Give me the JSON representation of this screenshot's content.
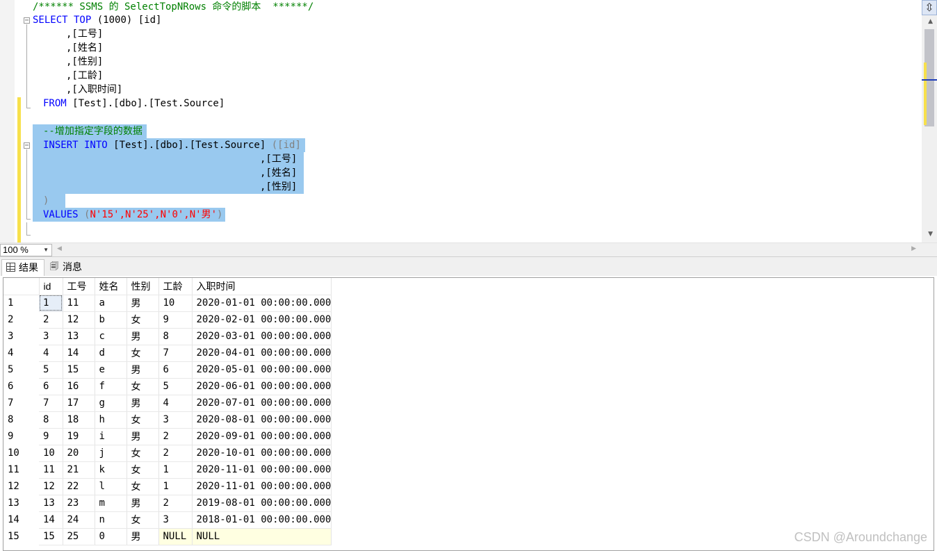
{
  "editor": {
    "comment_header": "/****** SSMS 的 SelectTopNRows 命令的脚本  ******/",
    "select_kw": "SELECT TOP",
    "select_rest": " (1000) [id]",
    "select_cols": [
      ",[工号]",
      ",[姓名]",
      ",[性别]",
      ",[工龄]",
      ",[入职时间]"
    ],
    "from_kw": "FROM",
    "from_rest": " [Test].[dbo].[Test.Source]",
    "comment_line": "--增加指定字段的数据",
    "insert_kw": "INSERT INTO",
    "insert_table": " [Test].[dbo].[Test.Source] ",
    "insert_first_col": "([id]",
    "insert_cols": [
      ",[工号]",
      ",[姓名]",
      ",[性别]"
    ],
    "close_paren": ")",
    "values_kw": "VALUES",
    "values_paren_open": " (",
    "values_items": "N'15',N'25',N'0',N'男'",
    "values_paren_close": ")"
  },
  "zoom": {
    "value": "100 %"
  },
  "tabs": [
    {
      "label": "结果",
      "icon": "grid-icon",
      "active": true
    },
    {
      "label": "消息",
      "icon": "messages-icon",
      "active": false
    }
  ],
  "results": {
    "columns": [
      "id",
      "工号",
      "姓名",
      "性别",
      "工龄",
      "入职时间"
    ],
    "rows": [
      [
        "1",
        "1",
        "11",
        "a",
        "男",
        "10",
        "2020-01-01 00:00:00.000"
      ],
      [
        "2",
        "2",
        "12",
        "b",
        "女",
        "9",
        "2020-02-01 00:00:00.000"
      ],
      [
        "3",
        "3",
        "13",
        "c",
        "男",
        "8",
        "2020-03-01 00:00:00.000"
      ],
      [
        "4",
        "4",
        "14",
        "d",
        "女",
        "7",
        "2020-04-01 00:00:00.000"
      ],
      [
        "5",
        "5",
        "15",
        "e",
        "男",
        "6",
        "2020-05-01 00:00:00.000"
      ],
      [
        "6",
        "6",
        "16",
        "f",
        "女",
        "5",
        "2020-06-01 00:00:00.000"
      ],
      [
        "7",
        "7",
        "17",
        "g",
        "男",
        "4",
        "2020-07-01 00:00:00.000"
      ],
      [
        "8",
        "8",
        "18",
        "h",
        "女",
        "3",
        "2020-08-01 00:00:00.000"
      ],
      [
        "9",
        "9",
        "19",
        "i",
        "男",
        "2",
        "2020-09-01 00:00:00.000"
      ],
      [
        "10",
        "10",
        "20",
        "j",
        "女",
        "2",
        "2020-10-01 00:00:00.000"
      ],
      [
        "11",
        "11",
        "21",
        "k",
        "女",
        "1",
        "2020-11-01 00:00:00.000"
      ],
      [
        "12",
        "12",
        "22",
        "l",
        "女",
        "1",
        "2020-11-01 00:00:00.000"
      ],
      [
        "13",
        "13",
        "23",
        "m",
        "男",
        "2",
        "2019-08-01 00:00:00.000"
      ],
      [
        "14",
        "14",
        "24",
        "n",
        "女",
        "3",
        "2018-01-01 00:00:00.000"
      ],
      [
        "15",
        "15",
        "25",
        "0",
        "男",
        "NULL",
        "NULL"
      ]
    ]
  },
  "watermark": "CSDN @Aroundchange",
  "colors": {
    "keyword": "#0000ff",
    "comment": "#008000",
    "string": "#ff0000",
    "selection": "#99c9ef",
    "change_bar": "#f7e04b",
    "null_cell": "#ffffe1"
  }
}
